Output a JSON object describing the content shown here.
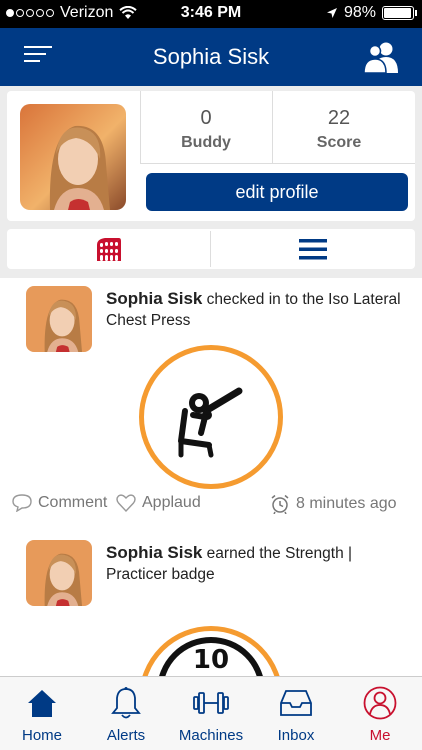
{
  "status_bar": {
    "carrier": "Verizon",
    "time": "3:46 PM",
    "battery": "98%",
    "battery_level": 0.98
  },
  "navbar": {
    "title": "Sophia Sisk",
    "menu_icon": "hamburger-menu-icon",
    "right_icon": "users-icon"
  },
  "profile": {
    "stats": [
      {
        "value": "0",
        "label": "Buddy"
      },
      {
        "value": "22",
        "label": "Score"
      }
    ],
    "edit_button": "edit profile",
    "tabs": [
      {
        "icon": "colosseum-icon"
      },
      {
        "icon": "list-icon"
      }
    ]
  },
  "feed": {
    "posts": [
      {
        "name": "Sophia Sisk",
        "text": " checked in to the Iso Lateral Chest Press",
        "badge_icon": "chest-press-machine-icon",
        "comment": "Comment",
        "applaud": "Applaud",
        "time": "8 minutes ago"
      },
      {
        "name": "Sophia Sisk",
        "text": " earned the Strength | Practicer badge",
        "badge_number": "10",
        "badge_icon": "strength-badge-icon"
      }
    ]
  },
  "tabbar": {
    "items": [
      {
        "label": "Home",
        "icon": "home-icon"
      },
      {
        "label": "Alerts",
        "icon": "bell-icon"
      },
      {
        "label": "Machines",
        "icon": "dumbbell-icon"
      },
      {
        "label": "Inbox",
        "icon": "inbox-icon"
      },
      {
        "label": "Me",
        "icon": "person-icon"
      }
    ]
  },
  "colors": {
    "brand_blue": "#003a85",
    "accent_orange": "#f59b30",
    "active_red": "#c8102e"
  }
}
